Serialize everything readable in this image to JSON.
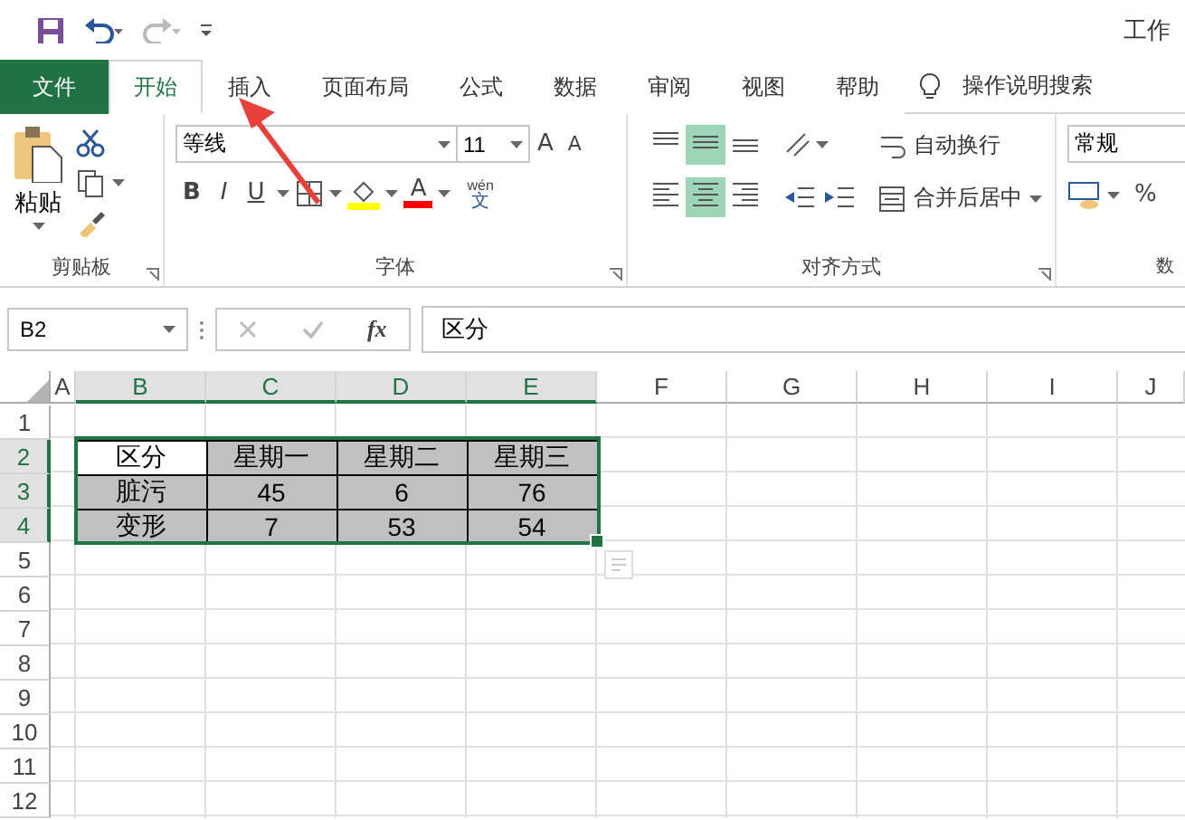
{
  "title_bar": {
    "title": "工作"
  },
  "tabs": [
    {
      "label": "文件",
      "kind": "file",
      "selected": false
    },
    {
      "label": "开始",
      "kind": "tab",
      "selected": true
    },
    {
      "label": "插入",
      "kind": "tab",
      "selected": false
    },
    {
      "label": "页面布局",
      "kind": "tab",
      "selected": false
    },
    {
      "label": "公式",
      "kind": "tab",
      "selected": false
    },
    {
      "label": "数据",
      "kind": "tab",
      "selected": false
    },
    {
      "label": "审阅",
      "kind": "tab",
      "selected": false
    },
    {
      "label": "视图",
      "kind": "tab",
      "selected": false
    },
    {
      "label": "帮助",
      "kind": "tab",
      "selected": false
    }
  ],
  "tell_me": "操作说明搜索",
  "ribbon": {
    "clipboard": {
      "paste": "粘贴",
      "label": "剪贴板"
    },
    "font": {
      "font_name": "等线",
      "font_size": "11",
      "grow": "A",
      "shrink": "A",
      "bold": "B",
      "italic": "I",
      "underline": "U",
      "font_color": "A",
      "phonetic_top": "wén",
      "phonetic_bottom": "文",
      "label": "字体"
    },
    "alignment": {
      "vertical": [
        {
          "kind": "top",
          "selected": false
        },
        {
          "kind": "middle",
          "selected": true
        },
        {
          "kind": "bottom",
          "selected": false
        }
      ],
      "horizontal": [
        {
          "kind": "left",
          "selected": false
        },
        {
          "kind": "center",
          "selected": true
        },
        {
          "kind": "right",
          "selected": false
        }
      ],
      "wrap": "自动换行",
      "merge": "合并后居中",
      "label": "对齐方式"
    },
    "number": {
      "format": "常规",
      "percent": "%",
      "label": "数"
    }
  },
  "formula_bar": {
    "name_box": "B2",
    "fx": "fx",
    "value": "区分"
  },
  "sheet": {
    "columns": [
      {
        "label": "A",
        "selected": false
      },
      {
        "label": "B",
        "selected": true
      },
      {
        "label": "C",
        "selected": true
      },
      {
        "label": "D",
        "selected": true
      },
      {
        "label": "E",
        "selected": true
      },
      {
        "label": "F",
        "selected": false
      },
      {
        "label": "G",
        "selected": false
      },
      {
        "label": "H",
        "selected": false
      },
      {
        "label": "I",
        "selected": false
      },
      {
        "label": "J",
        "selected": false
      }
    ],
    "rows": [
      {
        "label": "1",
        "selected": false,
        "cells": []
      },
      {
        "label": "2",
        "selected": true,
        "cells": [
          {
            "text": ""
          },
          {
            "text": "区分",
            "shaded": false
          },
          {
            "text": "星期一",
            "shaded": true
          },
          {
            "text": "星期二",
            "shaded": true
          },
          {
            "text": "星期三",
            "shaded": true
          }
        ]
      },
      {
        "label": "3",
        "selected": true,
        "cells": [
          {
            "text": ""
          },
          {
            "text": "脏污",
            "shaded": true
          },
          {
            "text": "45",
            "shaded": true
          },
          {
            "text": "6",
            "shaded": true
          },
          {
            "text": "76",
            "shaded": true
          }
        ]
      },
      {
        "label": "4",
        "selected": true,
        "cells": [
          {
            "text": ""
          },
          {
            "text": "变形",
            "shaded": true
          },
          {
            "text": "7",
            "shaded": true
          },
          {
            "text": "53",
            "shaded": true
          },
          {
            "text": "54",
            "shaded": true
          }
        ]
      },
      {
        "label": "5",
        "selected": false,
        "cells": []
      },
      {
        "label": "6",
        "selected": false,
        "cells": []
      },
      {
        "label": "7",
        "selected": false,
        "cells": []
      },
      {
        "label": "8",
        "selected": false,
        "cells": []
      },
      {
        "label": "9",
        "selected": false,
        "cells": []
      },
      {
        "label": "10",
        "selected": false,
        "cells": []
      },
      {
        "label": "11",
        "selected": false,
        "cells": []
      },
      {
        "label": "12",
        "selected": false,
        "cells": []
      }
    ]
  }
}
